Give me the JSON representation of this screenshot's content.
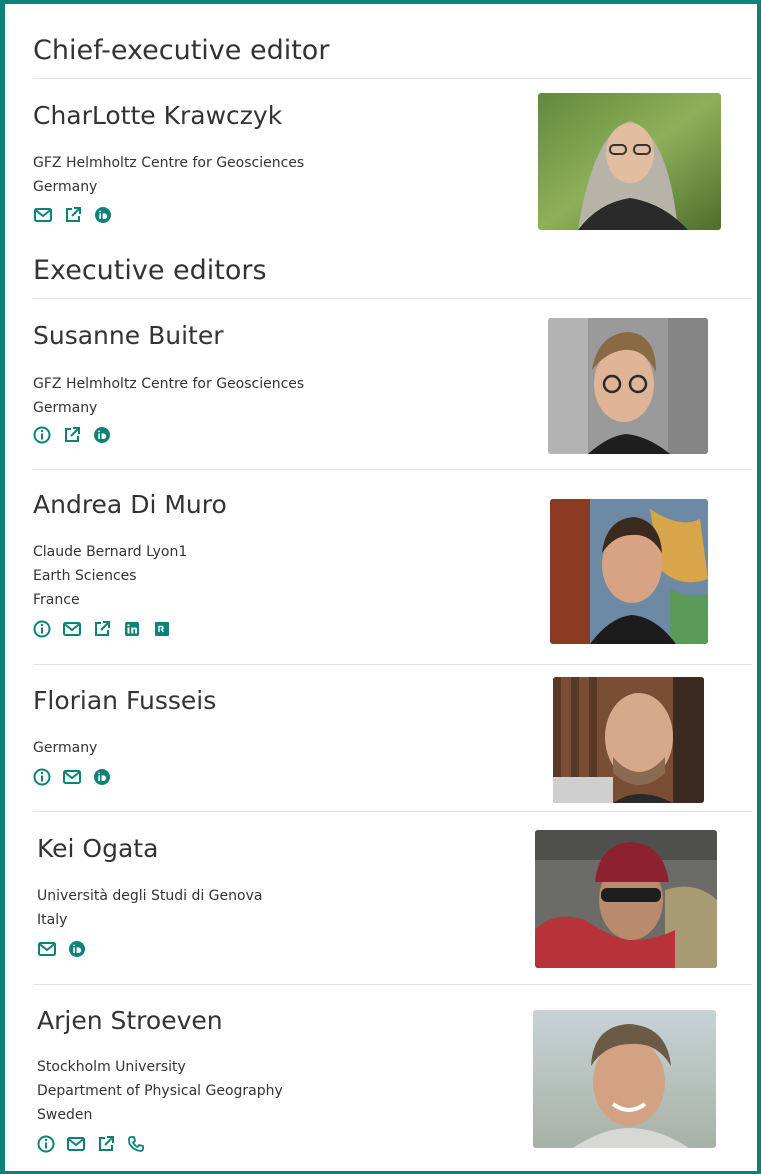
{
  "sections": {
    "chief_heading": "Chief-executive editor",
    "executive_heading": "Executive editors"
  },
  "editors": [
    {
      "name": "CharLotte Krawczyk",
      "lines": [
        "GFZ Helmholtz Centre for Geosciences",
        "Germany"
      ],
      "icons": [
        "mail-icon",
        "external-link-icon",
        "orcid-icon"
      ]
    },
    {
      "name": "Susanne Buiter",
      "lines": [
        "GFZ Helmholtz Centre for Geosciences",
        "Germany"
      ],
      "icons": [
        "info-icon",
        "external-link-icon",
        "orcid-icon"
      ]
    },
    {
      "name": "Andrea Di Muro",
      "lines": [
        "Claude Bernard Lyon1",
        "Earth Sciences",
        "France"
      ],
      "icons": [
        "info-icon",
        "mail-icon",
        "external-link-icon",
        "linkedin-icon",
        "researchgate-icon"
      ]
    },
    {
      "name": "Florian Fusseis",
      "lines": [
        "Germany"
      ],
      "icons": [
        "info-icon",
        "mail-icon",
        "orcid-icon"
      ]
    },
    {
      "name": "Kei Ogata",
      "lines": [
        "Università degli Studi di Genova",
        "Italy"
      ],
      "icons": [
        "mail-icon",
        "orcid-icon"
      ]
    },
    {
      "name": "Arjen Stroeven",
      "lines": [
        "Stockholm University",
        "Department of Physical Geography",
        "Sweden"
      ],
      "icons": [
        "info-icon",
        "mail-icon",
        "external-link-icon",
        "phone-icon"
      ]
    }
  ],
  "colors": {
    "accent": "#0e8279",
    "text": "#333333",
    "rule": "#e3e3e3"
  }
}
